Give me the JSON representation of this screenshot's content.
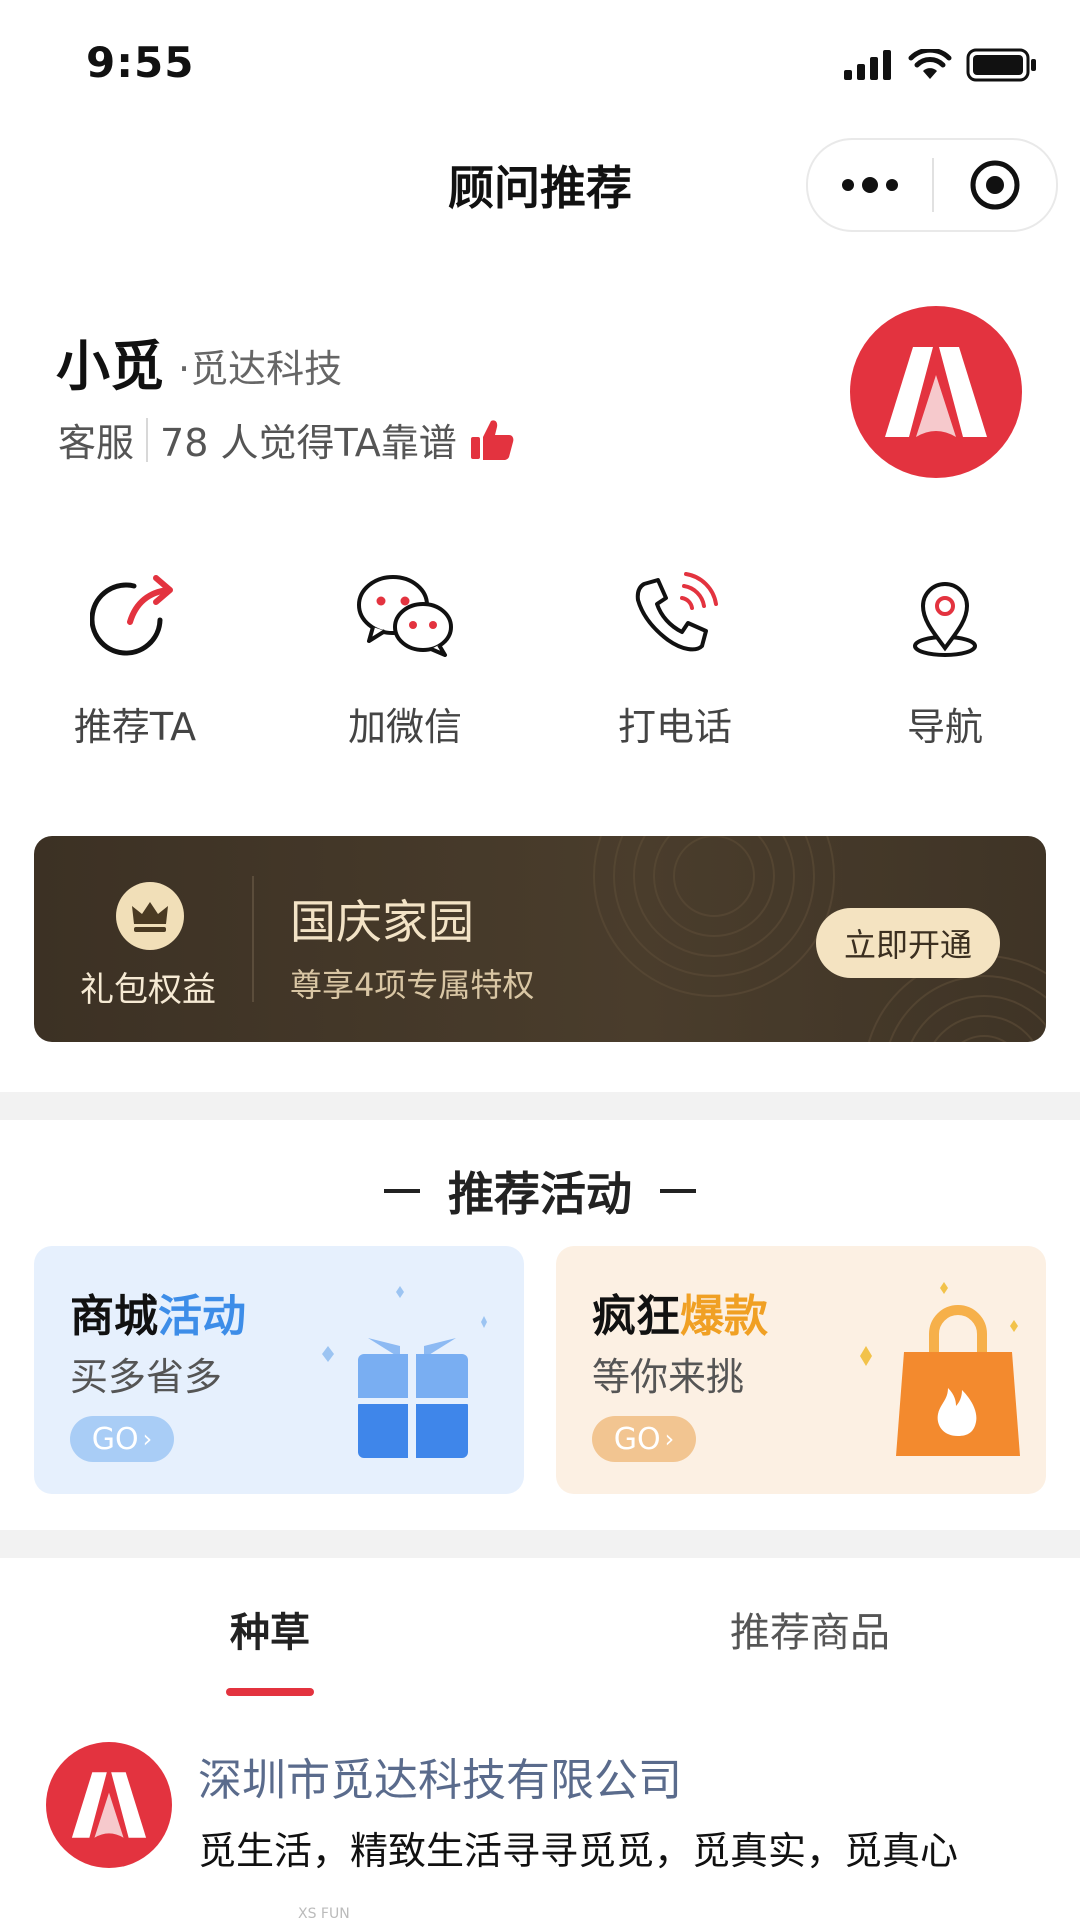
{
  "status_bar": {
    "time": "9:55"
  },
  "nav": {
    "title": "顾问推荐"
  },
  "profile": {
    "name": "小觅",
    "company": "·觅达科技",
    "role": "客服",
    "approval_text": "78 人觉得TA靠谱"
  },
  "actions": [
    {
      "label": "推荐TA",
      "icon": "share-arrow-icon"
    },
    {
      "label": "加微信",
      "icon": "wechat-icon"
    },
    {
      "label": "打电话",
      "icon": "phone-icon"
    },
    {
      "label": "导航",
      "icon": "location-pin-icon"
    }
  ],
  "gift_banner": {
    "badge_label": "礼包权益",
    "title": "国庆家园",
    "subtitle": "尊享4项专属特权",
    "button_label": "立即开通"
  },
  "recommended_activities": {
    "section_title": "推荐活动",
    "cards": [
      {
        "title_main": "商城",
        "title_highlight": "活动",
        "subtitle": "买多省多",
        "go_label": "GO",
        "highlight_color": "#3d8de8"
      },
      {
        "title_main": "疯狂",
        "title_highlight": "爆款",
        "subtitle": "等你来挑",
        "go_label": "GO",
        "highlight_color": "#f0a024"
      }
    ]
  },
  "tabs": [
    {
      "label": "种草",
      "active": true
    },
    {
      "label": "推荐商品",
      "active": false
    }
  ],
  "feed": {
    "company_name": "深圳市觅达科技有限公司",
    "text": "觅生活，精致生活寻寻觅觅，觅真实，觅真心",
    "partial_caption": "XS FUN"
  },
  "colors": {
    "brand_red": "#e3333f",
    "banner_dark": "#3c3124"
  }
}
